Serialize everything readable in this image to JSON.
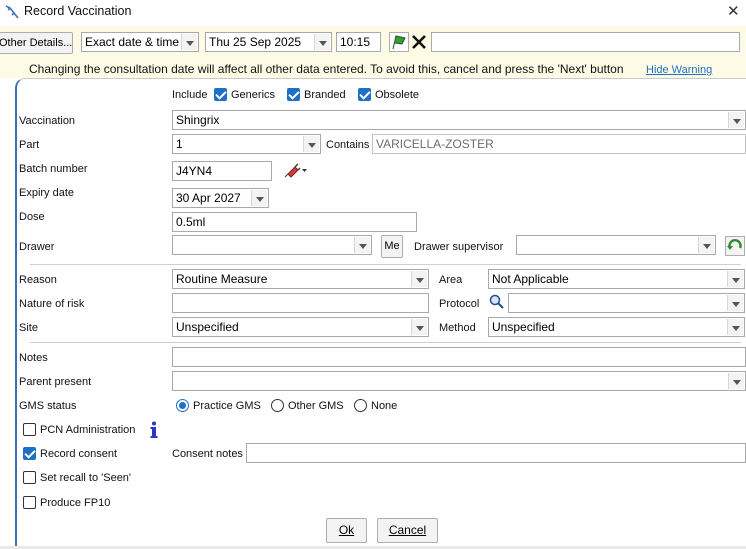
{
  "window": {
    "title": "Record Vaccination",
    "close_glyph": "✕",
    "icon": "syringe-app-icon"
  },
  "toolbar": {
    "other_details_label": "Other Details...",
    "date_mode": "Exact date & time",
    "date": "Thu 25 Sep 2025",
    "time": "10:15",
    "free_text": ""
  },
  "warning": {
    "text": "Changing the consultation date will affect all other data entered. To avoid this, cancel and press the 'Next' button",
    "hide_label": "Hide Warning"
  },
  "include": {
    "label": "Include",
    "generics": {
      "label": "Generics",
      "checked": true
    },
    "branded": {
      "label": "Branded",
      "checked": true
    },
    "obsolete": {
      "label": "Obsolete",
      "checked": true
    }
  },
  "fields": {
    "vaccination": {
      "label": "Vaccination",
      "value": "Shingrix"
    },
    "part": {
      "label": "Part",
      "value": "1"
    },
    "contains": {
      "label": "Contains",
      "value": "VARICELLA-ZOSTER"
    },
    "batch": {
      "label": "Batch number",
      "value": "J4YN4"
    },
    "expiry": {
      "label": "Expiry date",
      "value": "30 Apr 2027"
    },
    "dose": {
      "label": "Dose",
      "value": "0.5ml"
    },
    "drawer": {
      "label": "Drawer",
      "value": "",
      "me_label": "Me"
    },
    "drawer_supervisor": {
      "label": "Drawer supervisor",
      "value": ""
    },
    "reason": {
      "label": "Reason",
      "value": "Routine Measure"
    },
    "area": {
      "label": "Area",
      "value": "Not Applicable"
    },
    "nature_of_risk": {
      "label": "Nature of risk",
      "value": ""
    },
    "protocol": {
      "label": "Protocol",
      "value": ""
    },
    "site": {
      "label": "Site",
      "value": "Unspecified"
    },
    "method": {
      "label": "Method",
      "value": "Unspecified"
    },
    "notes": {
      "label": "Notes",
      "value": ""
    },
    "parent_present": {
      "label": "Parent present",
      "value": ""
    },
    "consent_notes": {
      "label": "Consent notes",
      "value": ""
    }
  },
  "gms": {
    "label": "GMS status",
    "options": [
      {
        "label": "Practice GMS",
        "selected": true
      },
      {
        "label": "Other GMS",
        "selected": false
      },
      {
        "label": "None",
        "selected": false
      }
    ]
  },
  "checks": {
    "pcn": {
      "label": "PCN Administration",
      "checked": false
    },
    "record_consent": {
      "label": "Record consent",
      "checked": true
    },
    "set_recall": {
      "label": "Set recall to 'Seen'",
      "checked": false
    },
    "produce_fp10": {
      "label": "Produce FP10",
      "checked": false
    }
  },
  "buttons": {
    "ok": "Ok",
    "cancel": "Cancel"
  },
  "colors": {
    "accent": "#1f6fc5",
    "toolbar_bg": "#fdfbe6",
    "panel_border": "#3c6fb4",
    "confirm_green": "#3a9a3a",
    "refresh_green": "#2e8b2e"
  }
}
